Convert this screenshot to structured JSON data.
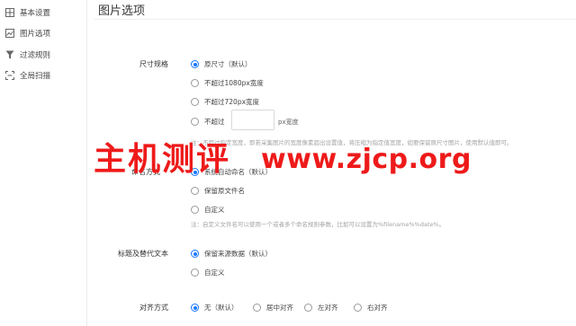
{
  "sidebar": {
    "items": [
      {
        "label": "基本设置",
        "icon": "settings-grid-icon"
      },
      {
        "label": "图片选项",
        "icon": "image-chart-icon"
      },
      {
        "label": "过滤规则",
        "icon": "filter-icon"
      },
      {
        "label": "全局扫描",
        "icon": "scan-icon"
      }
    ]
  },
  "main": {
    "title": "图片选项",
    "size": {
      "label": "尺寸规格",
      "options": [
        "原尺寸（默认）",
        "不超过1080px宽度",
        "不超过720px宽度",
        "不超过"
      ],
      "custom_value": "",
      "custom_suffix": "px宽度",
      "selected": 0,
      "note": "注：不超过指定宽度，即若采集图片的宽度像素超出设置值，将压缩为指定值宽度，如要保留原尺寸图片，使用默认值即可。"
    },
    "naming": {
      "label": "命名方式",
      "options": [
        "系统自动命名（默认）",
        "保留原文件名",
        "自定义"
      ],
      "selected": 0,
      "note": "注：自定义文件名可以使用一个或者多个命名规则参数，比如可以设置为%filename%%date%。"
    },
    "title_alt": {
      "label": "标题及替代文本",
      "options": [
        "保留来源数据（默认）",
        "自定义"
      ],
      "selected": 0
    },
    "align": {
      "label": "对齐方式",
      "options": [
        "无（默认）",
        "居中对齐",
        "左对齐",
        "右对齐"
      ],
      "selected": 0
    }
  },
  "watermark": {
    "chinese": "主机测评",
    "url": "www.zjcp.org"
  },
  "colors": {
    "accent": "#1677ff",
    "watermark": "#ee1a1a"
  }
}
